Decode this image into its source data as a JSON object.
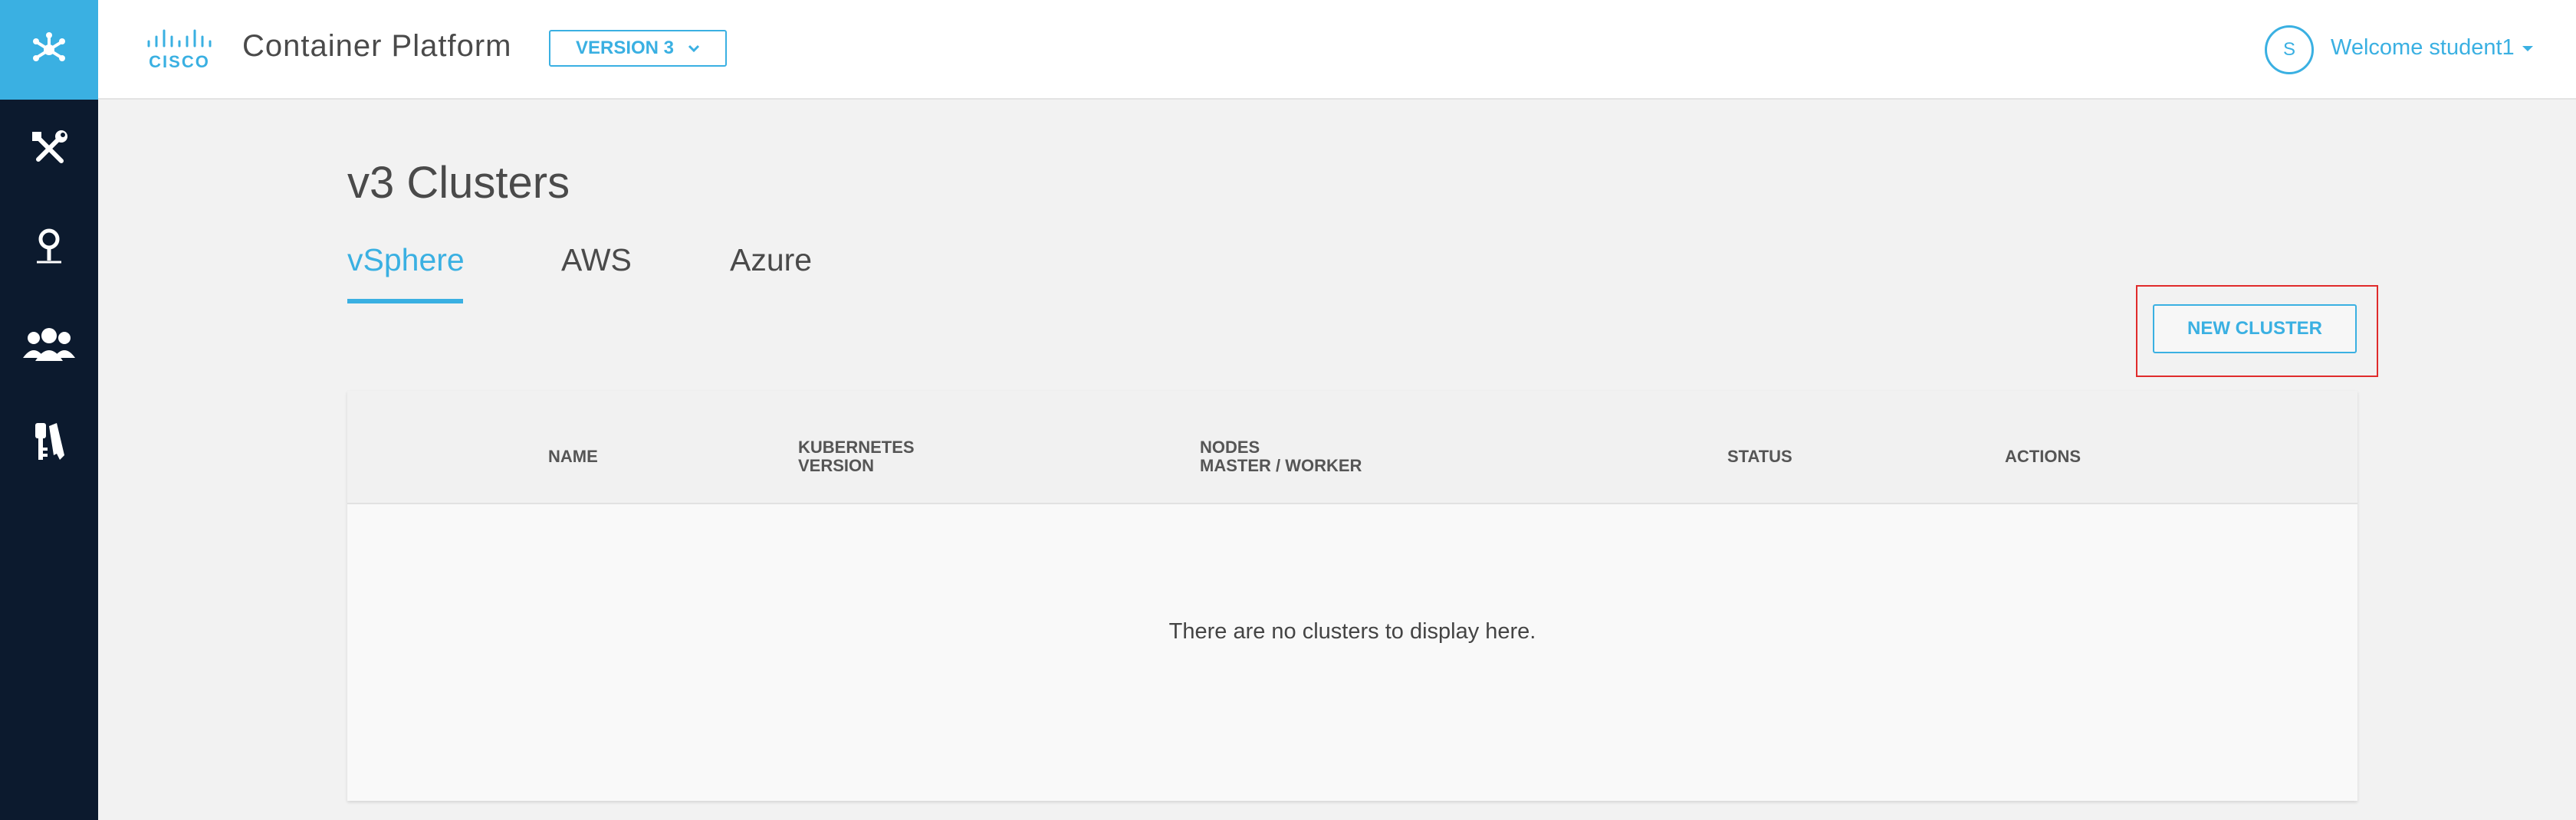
{
  "app": {
    "title": "Container Platform",
    "version_label": "VERSION 3"
  },
  "user": {
    "avatar_initial": "S",
    "welcome": "Welcome student1"
  },
  "sidebar": {
    "items": [
      {
        "icon": "tools-icon"
      },
      {
        "icon": "location-pin-icon"
      },
      {
        "icon": "users-icon"
      },
      {
        "icon": "keys-icon"
      }
    ]
  },
  "page": {
    "title": "v3 Clusters",
    "tabs": [
      {
        "label": "vSphere",
        "active": true
      },
      {
        "label": "AWS",
        "active": false
      },
      {
        "label": "Azure",
        "active": false
      }
    ],
    "new_cluster_label": "NEW CLUSTER"
  },
  "table": {
    "columns": [
      {
        "line1": "NAME",
        "line2": ""
      },
      {
        "line1": "KUBERNETES",
        "line2": "VERSION"
      },
      {
        "line1": "NODES",
        "line2": "MASTER / WORKER"
      },
      {
        "line1": "STATUS",
        "line2": ""
      },
      {
        "line1": "ACTIONS",
        "line2": ""
      }
    ],
    "empty_message": "There are no clusters to display here."
  },
  "colors": {
    "accent": "#3ab0e2",
    "sidebar_bg": "#0c1a2e",
    "highlight": "#e02b2b"
  }
}
